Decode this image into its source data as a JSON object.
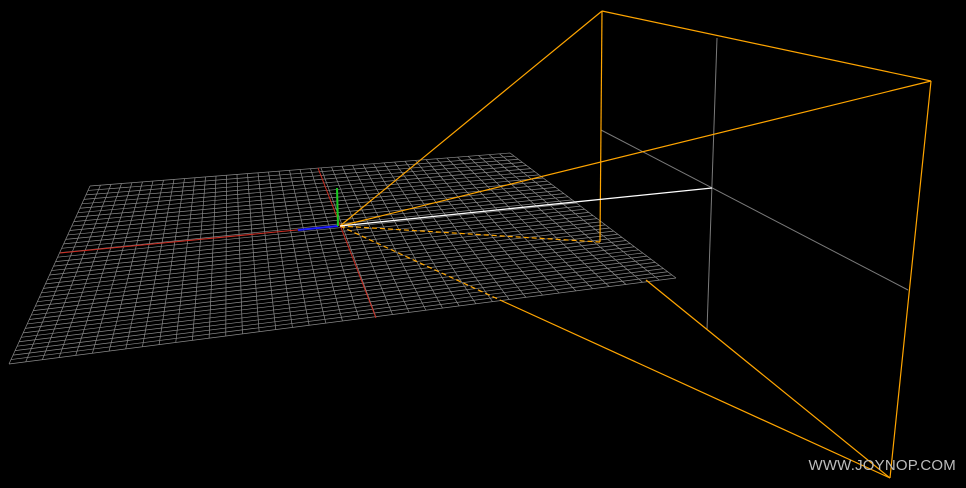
{
  "scene": {
    "background_color": "#000000",
    "grid": {
      "color": "#8a8a8a",
      "divisions": 40,
      "origin_line_x_color": "#cc2a1f",
      "origin_line_z_color": "#cc2a1f"
    },
    "axes": {
      "x_color": "#1a1aff",
      "y_color": "#19c81e"
    },
    "camera_frustum": {
      "color": "#ffa500",
      "dashed_hidden_edges": true
    },
    "target_line_color": "#ffffff"
  },
  "watermark": {
    "text": "WWW.JOYNOP.COM"
  }
}
